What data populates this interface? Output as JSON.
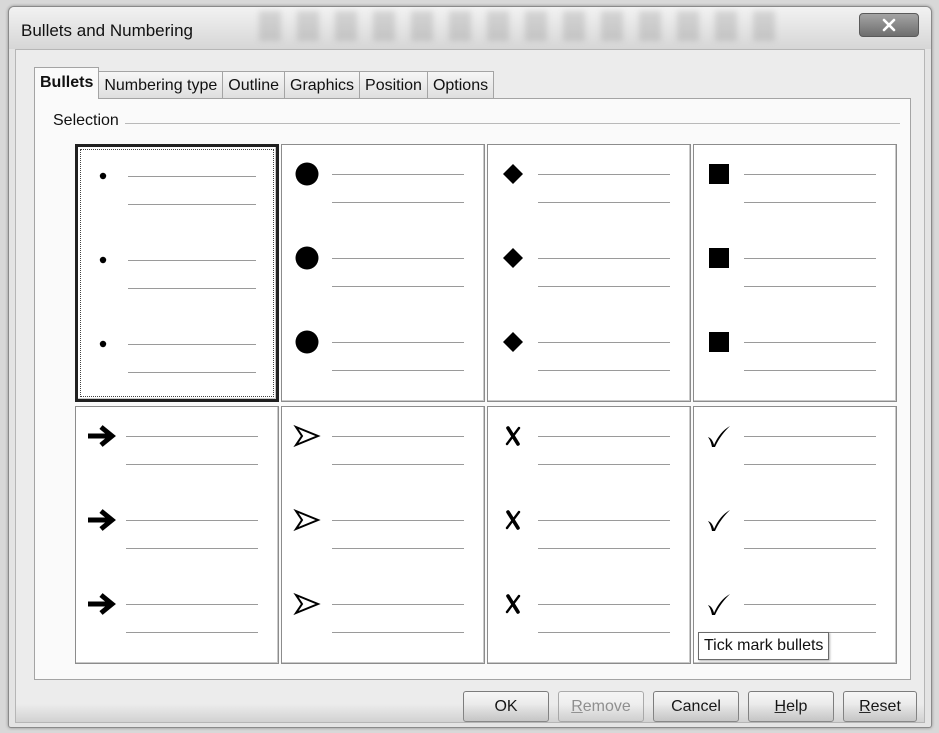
{
  "window": {
    "title": "Bullets and Numbering"
  },
  "tabs": [
    {
      "label": "Bullets",
      "active": true
    },
    {
      "label": "Numbering type",
      "active": false
    },
    {
      "label": "Outline",
      "active": false
    },
    {
      "label": "Graphics",
      "active": false
    },
    {
      "label": "Position",
      "active": false
    },
    {
      "label": "Options",
      "active": false
    }
  ],
  "selection": {
    "label": "Selection",
    "selected_index": 0,
    "styles": [
      {
        "icon": "small-dot-icon"
      },
      {
        "icon": "large-circle-icon"
      },
      {
        "icon": "diamond-icon"
      },
      {
        "icon": "square-icon"
      },
      {
        "icon": "arrow-icon"
      },
      {
        "icon": "arrowhead-icon"
      },
      {
        "icon": "cross-mark-icon"
      },
      {
        "icon": "tick-mark-icon"
      }
    ]
  },
  "tooltip": {
    "text": "Tick mark bullets"
  },
  "buttons": {
    "ok": {
      "label": "OK"
    },
    "remove": {
      "pre": "",
      "mnemonic": "R",
      "post": "emove",
      "disabled": true
    },
    "cancel": {
      "label": "Cancel"
    },
    "help": {
      "pre": "",
      "mnemonic": "H",
      "post": "elp"
    },
    "reset": {
      "pre": "",
      "mnemonic": "R",
      "post": "eset"
    }
  },
  "colors": {
    "dialog_bg": "#ececec",
    "panel_bg": "#fafafa",
    "close_button": "#7a7a7a"
  }
}
